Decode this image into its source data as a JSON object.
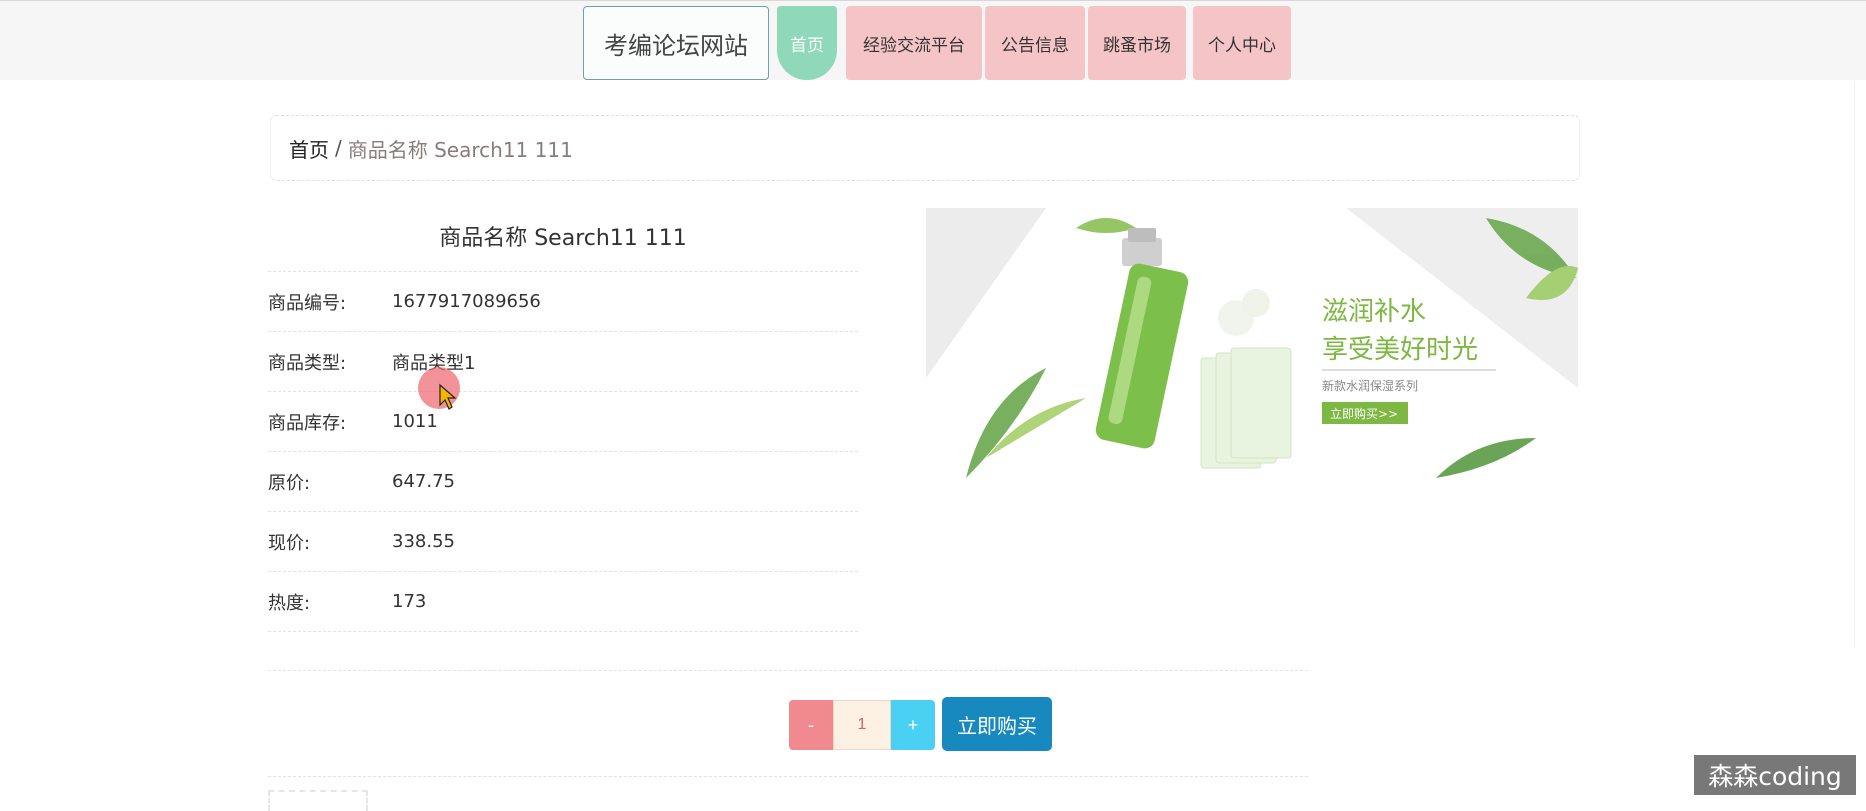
{
  "header": {
    "site_title": "考编论坛网站",
    "nav": [
      {
        "label": "首页",
        "active": true
      },
      {
        "label": "经验交流平台",
        "active": false
      },
      {
        "label": "公告信息",
        "active": false
      },
      {
        "label": "跳蚤市场",
        "active": false
      },
      {
        "label": "个人中心",
        "active": false
      }
    ]
  },
  "breadcrumb": {
    "home": "首页",
    "separator": "/",
    "current": "商品名称 Search11 111"
  },
  "product": {
    "title": "商品名称 Search11 111",
    "fields": [
      {
        "label": "商品编号:",
        "value": "1677917089656"
      },
      {
        "label": "商品类型:",
        "value": "商品类型1"
      },
      {
        "label": "商品库存:",
        "value": "1011"
      },
      {
        "label": "原价:",
        "value": "647.75"
      },
      {
        "label": "现价:",
        "value": "338.55"
      },
      {
        "label": "热度:",
        "value": "173"
      }
    ]
  },
  "banner": {
    "headline_1": "滋润补水",
    "headline_2": "享受美好时光",
    "subtitle": "新款水润保湿系列",
    "cta": "立即购买>>"
  },
  "purchase": {
    "minus": "-",
    "quantity": "1",
    "plus": "+",
    "buy_label": "立即购买"
  },
  "watermark": "森森coding",
  "colors": {
    "nav_active": "#8fd8ba",
    "nav_inactive": "#f5c4c6",
    "buy_button": "#1889bf",
    "minus_button": "#f08a8e",
    "plus_button": "#4ad0f2"
  }
}
